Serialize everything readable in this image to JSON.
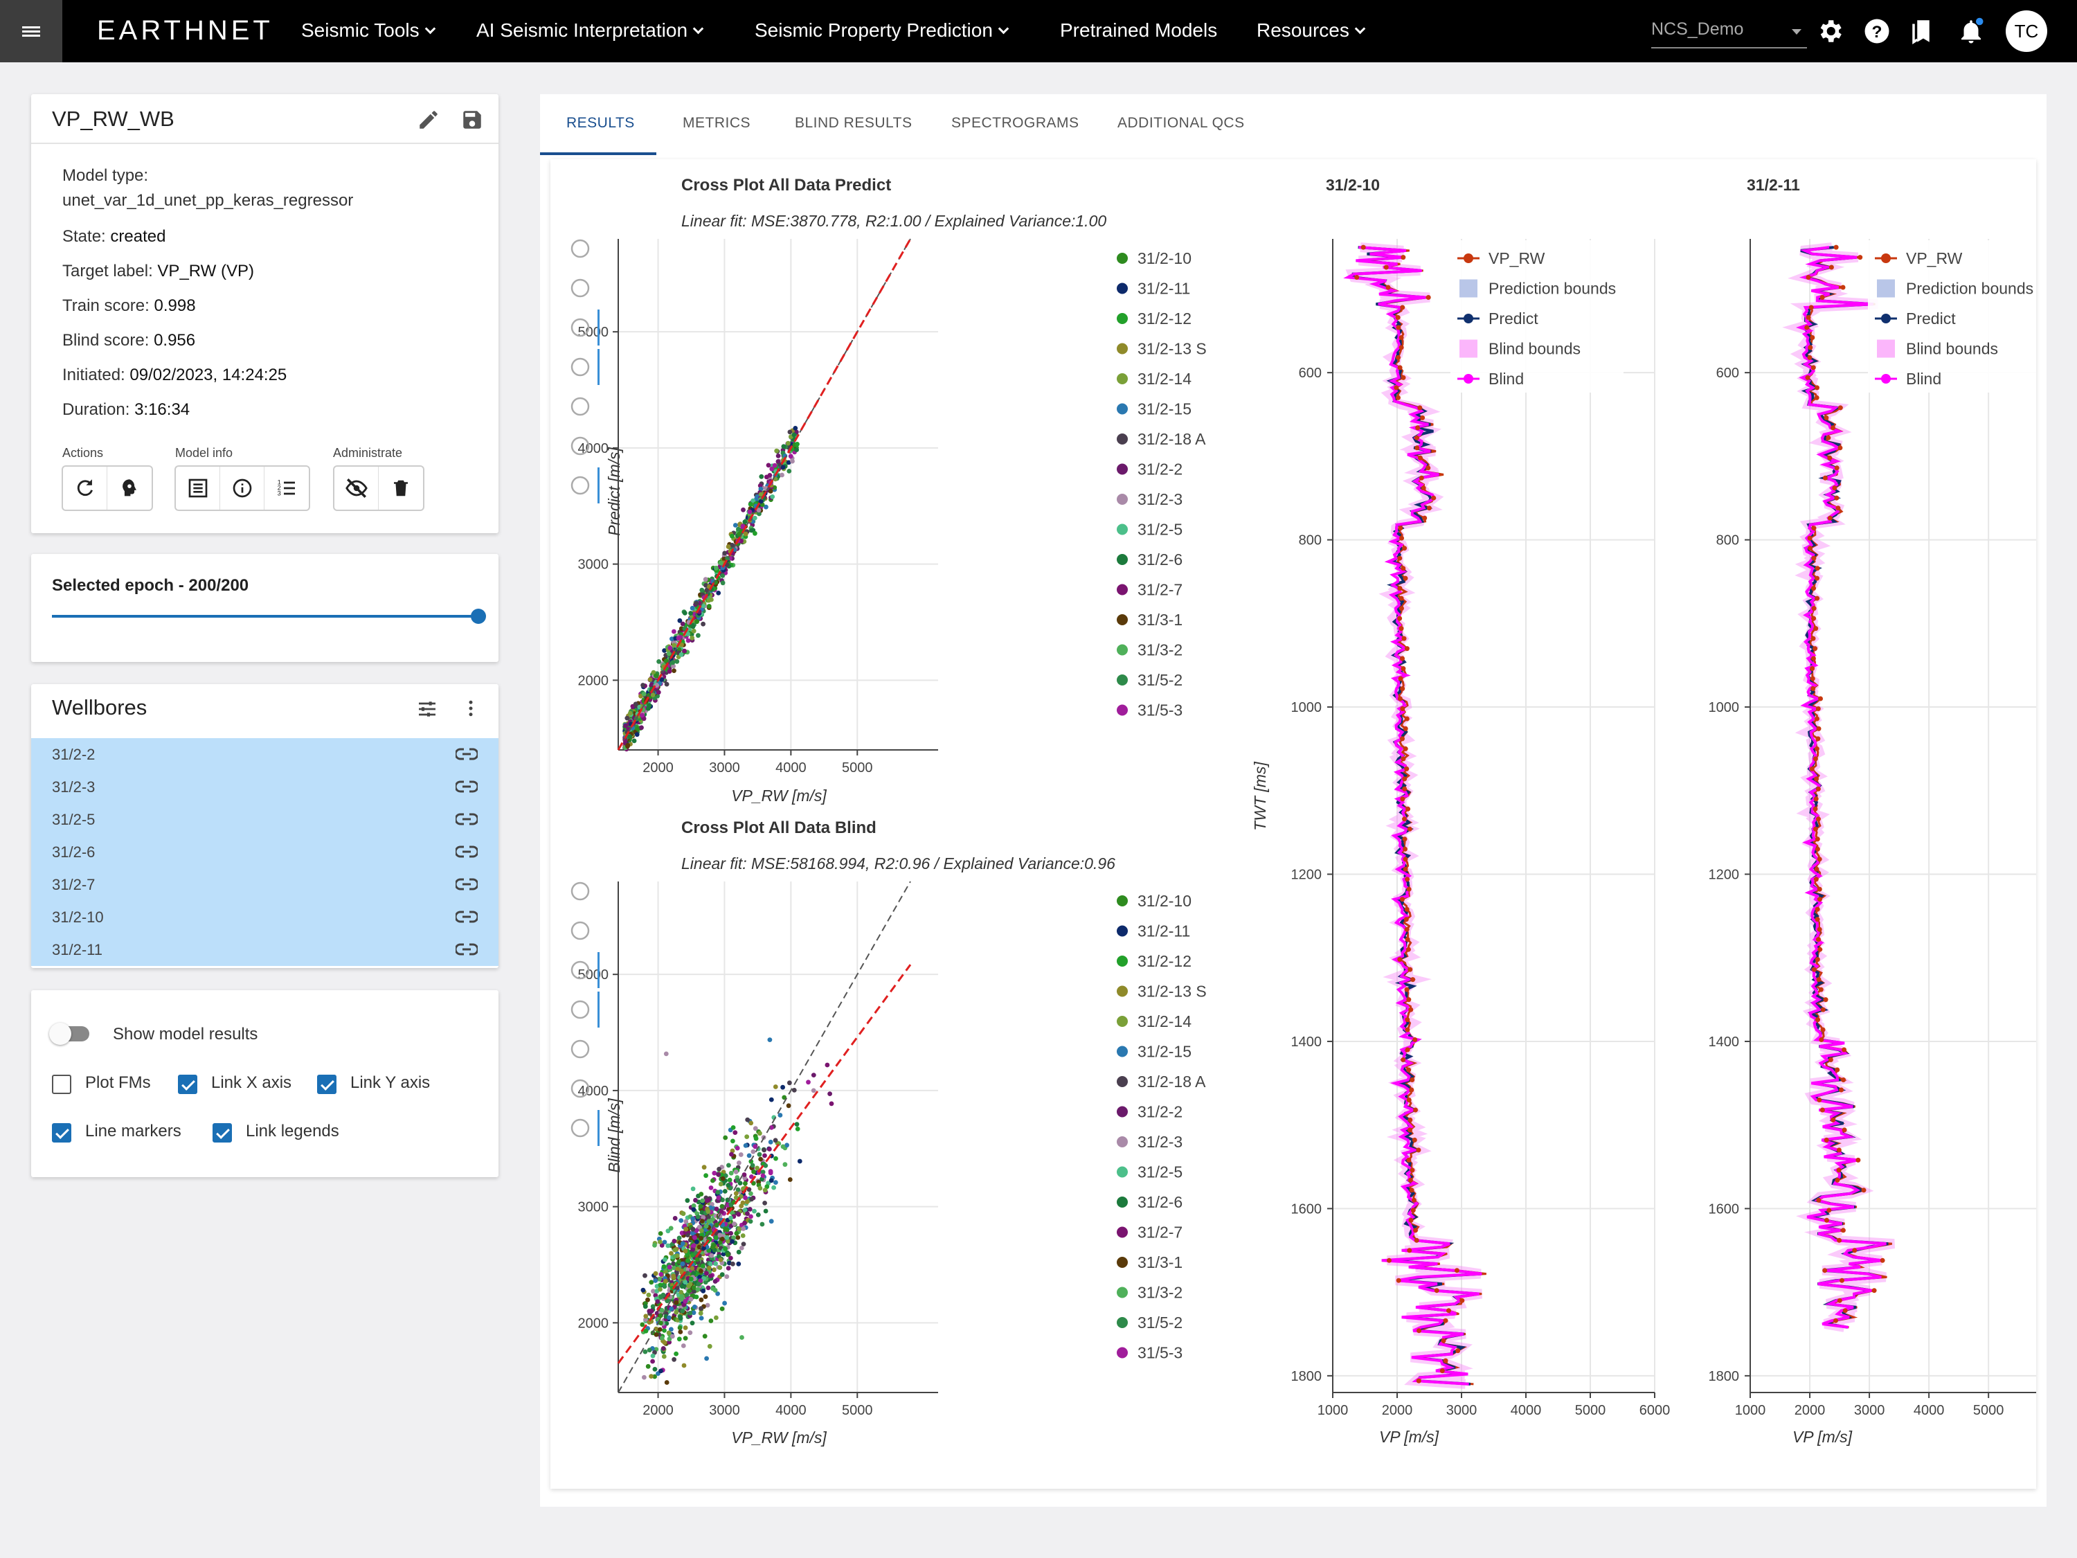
{
  "topbar": {
    "logo": "EARTHNET",
    "nav": [
      {
        "label": "Seismic Tools",
        "dropdown": true
      },
      {
        "label": "AI Seismic Interpretation",
        "dropdown": true
      },
      {
        "label": "Seismic Property Prediction",
        "dropdown": true
      },
      {
        "label": "Pretrained Models",
        "dropdown": false
      },
      {
        "label": "Resources",
        "dropdown": true
      }
    ],
    "project": "NCS_Demo",
    "avatar": "TC"
  },
  "model_card": {
    "title": "VP_RW_WB",
    "model_type_label": "Model type:",
    "model_type": "unet_var_1d_unet_pp_keras_regressor",
    "state_label": "State:",
    "state": "created",
    "target_label_label": "Target label:",
    "target_label": "VP_RW (VP)",
    "train_label": "Train score:",
    "train": "0.998",
    "blind_label": "Blind score:",
    "blind": "0.956",
    "initiated_label": "Initiated:",
    "initiated": "09/02/2023, 14:24:25",
    "duration_label": "Duration:",
    "duration": "3:16:34",
    "groups": {
      "actions": "Actions",
      "model_info": "Model info",
      "administrate": "Administrate"
    }
  },
  "epoch": {
    "label": "Selected epoch - 200/200",
    "value": 200,
    "max": 200
  },
  "wellbores": {
    "title": "Wellbores",
    "items": [
      "31/2-2",
      "31/2-3",
      "31/2-5",
      "31/2-6",
      "31/2-7",
      "31/2-10",
      "31/2-11"
    ]
  },
  "options": {
    "show_model_results": "Show model results",
    "show_model_results_on": false,
    "plot_fms": "Plot FMs",
    "link_x": "Link X axis",
    "link_y": "Link Y axis",
    "line_markers": "Line markers",
    "link_legends": "Link legends",
    "checked": {
      "plot_fms": false,
      "link_x": true,
      "link_y": true,
      "line_markers": true,
      "link_legends": true
    }
  },
  "tabs": [
    "RESULTS",
    "METRICS",
    "BLIND RESULTS",
    "SPECTROGRAMS",
    "ADDITIONAL QCS"
  ],
  "active_tab": "RESULTS",
  "colors": {
    "accent": "#1a4f8f",
    "selection": "#bcdffa",
    "vp_rw": "#c8380f",
    "predict": "#10306e",
    "blind": "#ff00ff"
  },
  "chart_data": [
    {
      "type": "scatter",
      "title": "Cross Plot All Data Predict",
      "subtitle": "Linear fit: MSE:3870.778, R2:1.00 / Explained Variance:1.00",
      "xlabel": "VP_RW [m/s]",
      "ylabel": "Predict [m/s]",
      "xlim": [
        1400,
        5800
      ],
      "ylim": [
        1400,
        5800
      ],
      "xticks": [
        "2000",
        "3000",
        "4000",
        "5000"
      ],
      "yticks": [
        "2000",
        "3000",
        "4000",
        "5000"
      ],
      "fit_slope": 1.0,
      "legend": [
        "31/2-10",
        "31/2-11",
        "31/2-12",
        "31/2-13 S",
        "31/2-14",
        "31/2-15",
        "31/2-18 A",
        "31/2-2",
        "31/2-3",
        "31/2-5",
        "31/2-6",
        "31/2-7",
        "31/3-1",
        "31/3-2",
        "31/5-2",
        "31/5-3"
      ],
      "legend_colors": [
        "#2e8b1f",
        "#0d2a6b",
        "#22a02a",
        "#8f8a2a",
        "#7aa038",
        "#2a78b0",
        "#4a3f4f",
        "#6b1a6b",
        "#a98aa8",
        "#4cbf8a",
        "#1c7a3c",
        "#7a1470",
        "#5a3a0a",
        "#4fb05a",
        "#2e8a4a",
        "#a01d9b"
      ],
      "legend_position": "top-right"
    },
    {
      "type": "scatter",
      "title": "Cross Plot All Data Blind",
      "subtitle": "Linear fit: MSE:58168.994, R2:0.96 / Explained Variance:0.96",
      "xlabel": "VP_RW [m/s]",
      "ylabel": "Blind [m/s]",
      "xlim": [
        1400,
        5800
      ],
      "ylim": [
        1400,
        5800
      ],
      "xticks": [
        "2000",
        "3000",
        "4000",
        "5000"
      ],
      "yticks": [
        "2000",
        "3000",
        "4000",
        "5000"
      ],
      "fit_slope": 0.78,
      "legend": [
        "31/2-10",
        "31/2-11",
        "31/2-12",
        "31/2-13 S",
        "31/2-14",
        "31/2-15",
        "31/2-18 A",
        "31/2-2",
        "31/2-3",
        "31/2-5",
        "31/2-6",
        "31/2-7",
        "31/3-1",
        "31/3-2",
        "31/5-2",
        "31/5-3"
      ],
      "legend_position": "top-right"
    },
    {
      "type": "line",
      "title": "31/2-10",
      "xlabel": "VP [m/s]",
      "ylabel": "TWT [ms]",
      "xlim": [
        1000,
        6000
      ],
      "ylim": [
        1820,
        440
      ],
      "xticks": [
        "1000",
        "2000",
        "3000",
        "4000",
        "5000",
        "6000"
      ],
      "yticks": [
        "600",
        "800",
        "1000",
        "1200",
        "1400",
        "1600",
        "1800"
      ],
      "legend": [
        "VP_RW",
        "Prediction bounds",
        "Predict",
        "Blind bounds",
        "Blind"
      ]
    },
    {
      "type": "line",
      "title": "31/2-11",
      "xlabel": "VP [m/s]",
      "ylabel": "",
      "xlim": [
        1000,
        5800
      ],
      "ylim": [
        1820,
        440
      ],
      "xticks": [
        "1000",
        "2000",
        "3000",
        "4000",
        "5000"
      ],
      "yticks": [
        "600",
        "800",
        "1000",
        "1200",
        "1400",
        "1600",
        "1800"
      ],
      "legend": [
        "VP_RW",
        "Prediction bounds",
        "Predict",
        "Blind bounds",
        "Blind"
      ]
    }
  ]
}
